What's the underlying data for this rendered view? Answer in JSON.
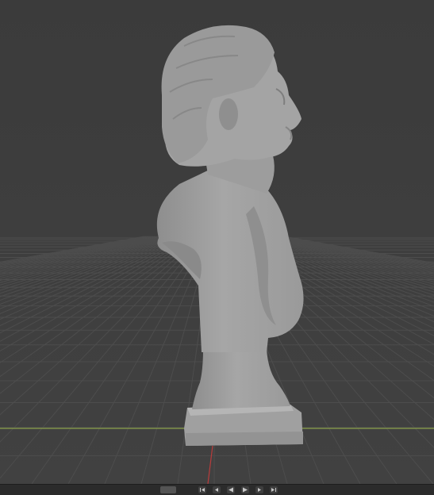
{
  "app": {
    "name": "3D viewport"
  },
  "viewport": {
    "background_color": "#3d3d3d",
    "grid_color": "#4d4d4d",
    "x_axis_color": "#8aa04a",
    "y_axis_color": "#b83c3c",
    "object": {
      "name": "bust-sculpture",
      "shading": "solid",
      "color": "#a3a3a3"
    }
  },
  "timeline": {
    "controls": [
      {
        "icon": "jump-start-icon"
      },
      {
        "icon": "step-back-icon"
      },
      {
        "icon": "play-reverse-icon"
      },
      {
        "icon": "play-icon"
      },
      {
        "icon": "step-forward-icon"
      },
      {
        "icon": "jump-end-icon"
      }
    ]
  }
}
